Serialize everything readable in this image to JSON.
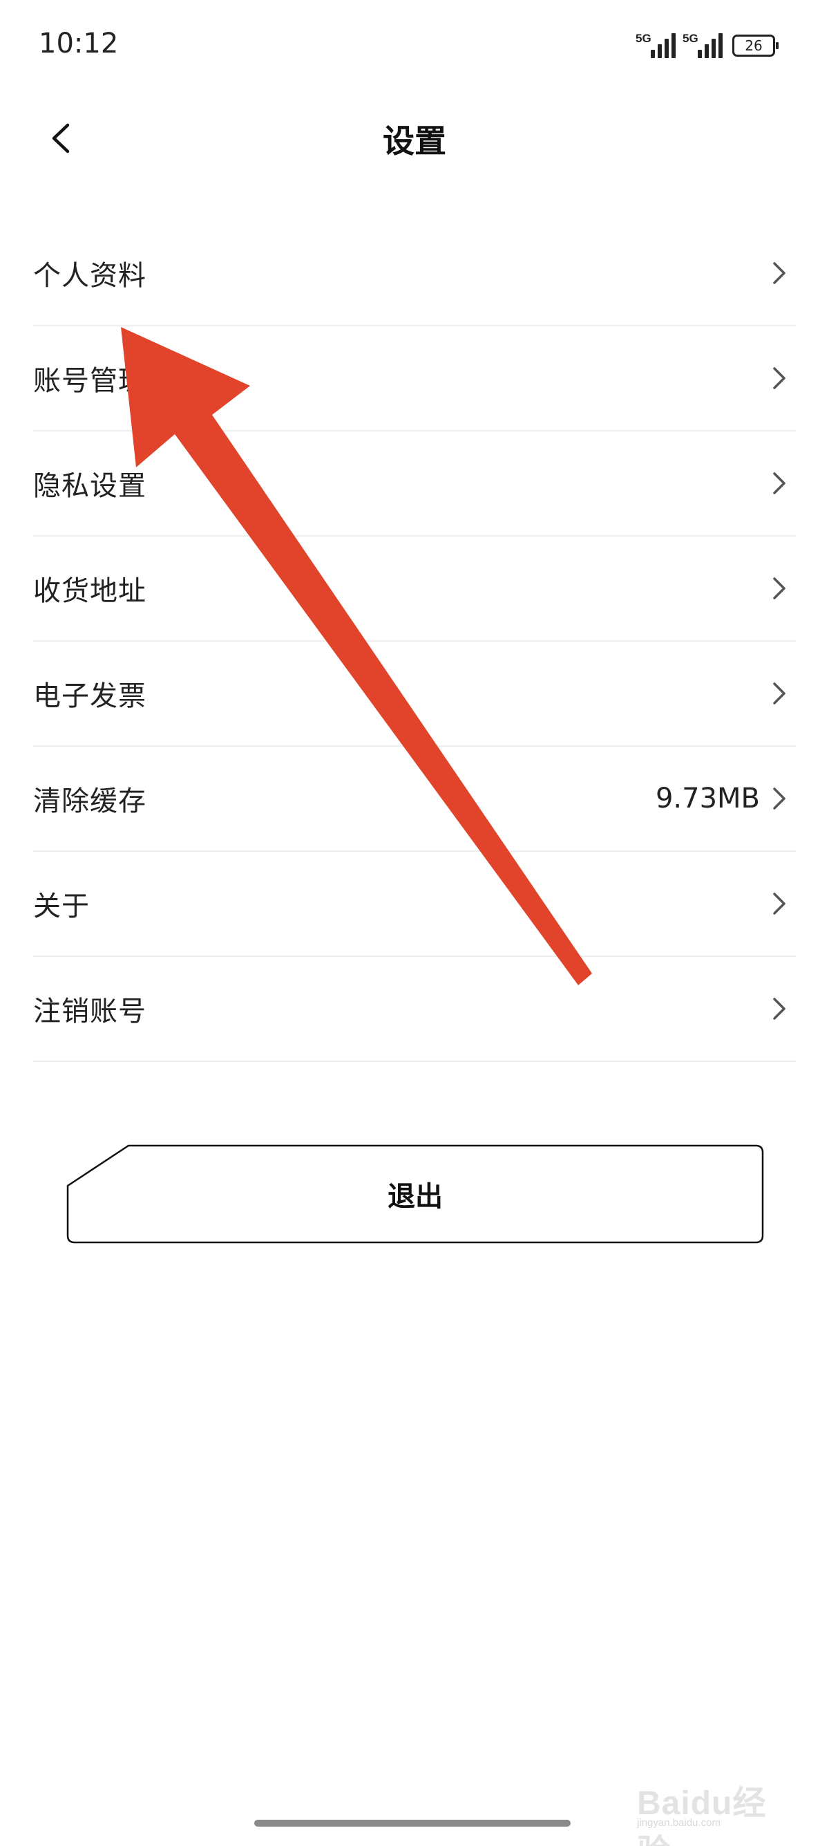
{
  "status_bar": {
    "time": "10:12",
    "signal_1_label": "5G",
    "signal_2_label": "5G",
    "battery": "26"
  },
  "header": {
    "back_icon": "chevron-left-icon",
    "title": "设置"
  },
  "settings": {
    "items": [
      {
        "label": "个人资料",
        "value": ""
      },
      {
        "label": "账号管理",
        "value": ""
      },
      {
        "label": "隐私设置",
        "value": ""
      },
      {
        "label": "收货地址",
        "value": ""
      },
      {
        "label": "电子发票",
        "value": ""
      },
      {
        "label": "清除缓存",
        "value": "9.73MB"
      },
      {
        "label": "关于",
        "value": ""
      },
      {
        "label": "注销账号",
        "value": ""
      }
    ],
    "chevron_icon": "chevron-right-icon"
  },
  "logout": {
    "label": "退出"
  },
  "annotation": {
    "arrow_color": "#e1442a"
  },
  "watermark": {
    "text": "Baidu经验",
    "url": "jingyan.baidu.com"
  }
}
